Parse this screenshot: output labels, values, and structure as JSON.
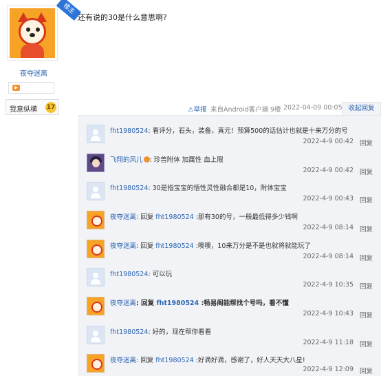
{
  "poster": {
    "badge": "楼主",
    "name": "夜夺迷离",
    "fan_label": "我意纵横",
    "fan_level": "17"
  },
  "post": {
    "text": "还有说的30是什么意思啊?",
    "report": "举报",
    "source": "来自Android客户端",
    "floor": "9楼",
    "time": "2022-04-09 00:05",
    "collapse": "收起回复"
  },
  "replies": [
    {
      "avatar": "default-avatar",
      "user": "fht1980524",
      "reply_word": "",
      "target": "",
      "content": ": 看评分，石头，装备，真元！预算500的话估计也就是十来万分的号",
      "time": "2022-4-9 00:42",
      "reply_link": "回复"
    },
    {
      "avatar": "anime-avatar",
      "user": "飞翔的风儿",
      "reply_word": "",
      "target": "",
      "content": ": 珍兽附体 加属性 血上限",
      "time": "2022-4-9 00:42",
      "reply_link": "回复"
    },
    {
      "avatar": "default-avatar",
      "user": "fht1980524",
      "reply_word": "",
      "target": "",
      "content": ": 30是指宝宝的悟性灵性融合都是10，附体宝宝",
      "time": "2022-4-9 00:43",
      "reply_link": "回复"
    },
    {
      "avatar": "fox-avatar",
      "user": "夜夺迷离",
      "reply_word": ": 回复 ",
      "target": "fht1980524",
      "content": " :那有30的号，一般最低得多少钱啊",
      "time": "2022-4-9 08:14",
      "reply_link": "回复"
    },
    {
      "avatar": "fox-avatar",
      "user": "夜夺迷离",
      "reply_word": ": 回复 ",
      "target": "fht1980524",
      "content": " :噢噢，10来万分是不是也就将就能玩了",
      "time": "2022-4-9 08:14",
      "reply_link": "回复"
    },
    {
      "avatar": "default-avatar",
      "user": "fht1980524",
      "reply_word": "",
      "target": "",
      "content": ": 可以玩",
      "time": "2022-4-9 10:35",
      "reply_link": "回复"
    },
    {
      "avatar": "fox-avatar",
      "user": "夜夺迷离",
      "reply_word": ": 回复 ",
      "target": "fht1980524",
      "content": " :畅易阁能帮找个号吗，看不懂",
      "time": "2022-4-9 10:43",
      "reply_link": "回复"
    },
    {
      "avatar": "default-avatar",
      "user": "fht1980524",
      "reply_word": "",
      "target": "",
      "content": ": 好的，现在帮你看看",
      "time": "2022-4-9 11:18",
      "reply_link": "回复"
    },
    {
      "avatar": "fox-avatar",
      "user": "夜夺迷离",
      "reply_word": ": 回复 ",
      "target": "fht1980524",
      "content": " :好滴好滴，感谢了，好人天天大八星!",
      "time": "2022-4-9 12:09",
      "reply_link": "回复"
    }
  ]
}
